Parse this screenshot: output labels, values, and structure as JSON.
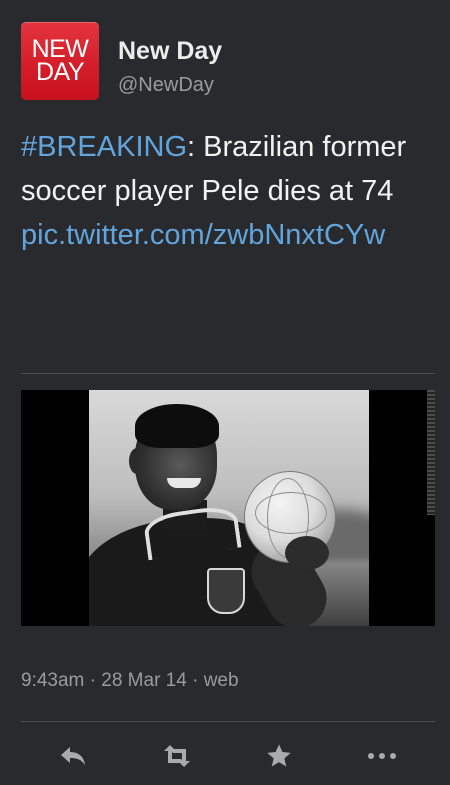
{
  "tweet": {
    "author": {
      "logo_line1": "NEW",
      "logo_line2": "DAY",
      "name": "New Day",
      "handle": "@NewDay"
    },
    "text": {
      "hashtag": "#BREAKING",
      "body": ": Brazilian former soccer player Pele dies at 74",
      "link": "pic.twitter.com/zwbNnxtCYw"
    },
    "media": {
      "kind": "photo"
    },
    "meta": {
      "time": "9:43am",
      "separator": " · ",
      "date": "28 Mar 14",
      "source": "web"
    },
    "actions": [
      {
        "icon": "reply-icon"
      },
      {
        "icon": "retweet-icon"
      },
      {
        "icon": "favorite-star-icon"
      },
      {
        "icon": "more-icon"
      }
    ]
  },
  "colors": {
    "background": "#292a2d",
    "brand_red": "#d41f2b",
    "link_blue": "#62a5dc",
    "muted_text": "#9a9ba0"
  }
}
